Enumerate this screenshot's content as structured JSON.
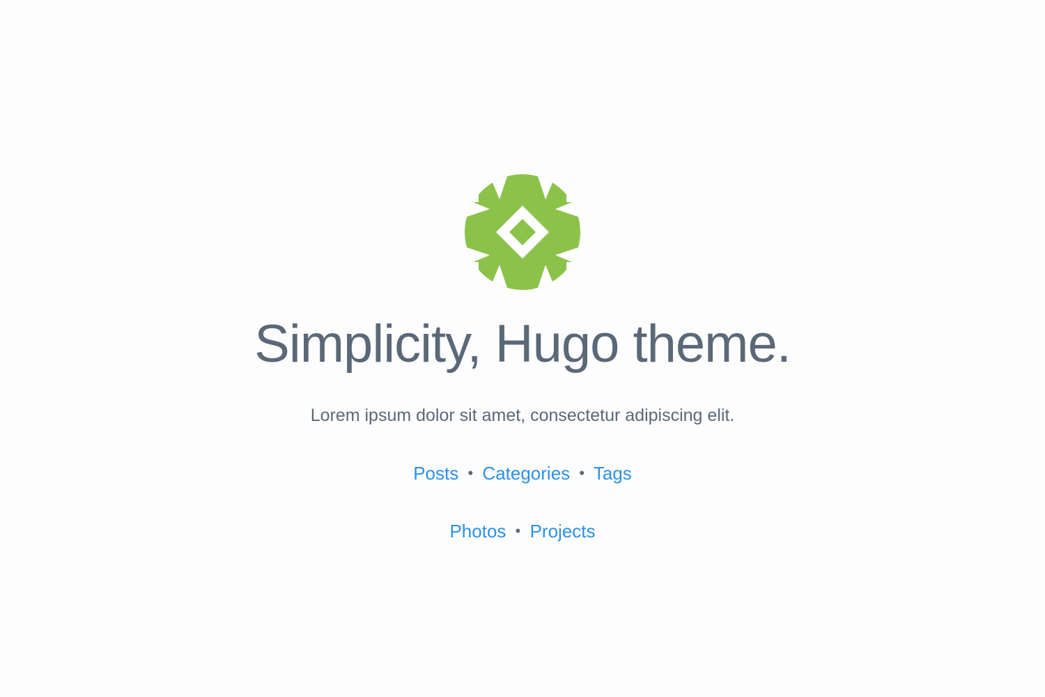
{
  "colors": {
    "background": "#fdfdfd",
    "text": "#5a6878",
    "link": "#2b90e9",
    "avatar_green": "#8bc34a"
  },
  "avatar": {
    "icon": "geometric-pattern-avatar-icon"
  },
  "header": {
    "title": "Simplicity, Hugo theme.",
    "tagline": "Lorem ipsum dolor sit amet, consectetur adipiscing elit."
  },
  "nav": {
    "separator": "•",
    "row1": [
      {
        "label": "Posts"
      },
      {
        "label": "Categories"
      },
      {
        "label": "Tags"
      }
    ],
    "row2": [
      {
        "label": "Photos"
      },
      {
        "label": "Projects"
      }
    ]
  }
}
